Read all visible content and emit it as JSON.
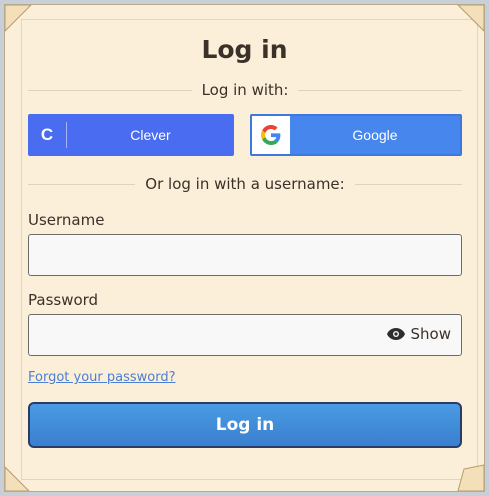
{
  "title": "Log in",
  "sso": {
    "heading": "Log in with:",
    "clever": {
      "label": "Clever",
      "letter": "C",
      "color": "#4a6cf0"
    },
    "google": {
      "label": "Google",
      "color": "#4786ec"
    }
  },
  "alt_heading": "Or log in with a username:",
  "username": {
    "label": "Username",
    "value": "",
    "placeholder": ""
  },
  "password": {
    "label": "Password",
    "value": "",
    "placeholder": "",
    "show_label": "Show"
  },
  "forgot_link": "Forgot your password?",
  "submit_label": "Log in",
  "colors": {
    "panel": "#fcefd9",
    "accent": "#3a7fd0",
    "link": "#4a7fd1"
  },
  "icons": [
    "clever-logo-icon",
    "google-logo-icon",
    "eye-icon"
  ]
}
